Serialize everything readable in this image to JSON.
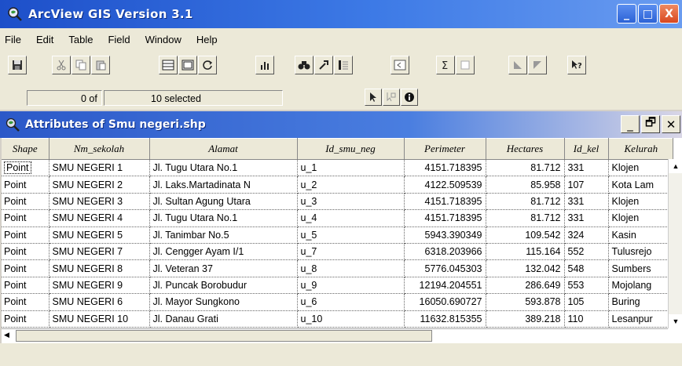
{
  "app": {
    "title": "ArcView GIS Version 3.1",
    "window_buttons": {
      "minimize": "_",
      "maximize": "□",
      "close": "X"
    }
  },
  "menu": [
    "File",
    "Edit",
    "Table",
    "Field",
    "Window",
    "Help"
  ],
  "status": {
    "count_value": "0 of",
    "selected_value": "10 selected"
  },
  "attributes_window": {
    "title": "Attributes of Smu negeri.shp",
    "buttons": {
      "minimize": "_",
      "restore": "🗗",
      "close": "✕"
    }
  },
  "table": {
    "columns": [
      "Shape",
      "Nm_sekolah",
      "Alamat",
      "Id_smu_neg",
      "Perimeter",
      "Hectares",
      "Id_kel",
      "Kelurah"
    ],
    "rows": [
      [
        "Point",
        "SMU NEGERI 1",
        "Jl. Tugu Utara No.1",
        "u_1",
        "4151.718395",
        "81.712",
        "331",
        "Klojen"
      ],
      [
        "Point",
        "SMU NEGERI 2",
        "Jl. Laks.Martadinata N",
        "u_2",
        "4122.509539",
        "85.958",
        "107",
        "Kota Lam"
      ],
      [
        "Point",
        "SMU NEGERI 3",
        "Jl. Sultan Agung Utara",
        "u_3",
        "4151.718395",
        "81.712",
        "331",
        "Klojen"
      ],
      [
        "Point",
        "SMU NEGERI 4",
        "Jl. Tugu Utara No.1",
        "u_4",
        "4151.718395",
        "81.712",
        "331",
        "Klojen"
      ],
      [
        "Point",
        "SMU NEGERI 5",
        "Jl. Tanimbar No.5",
        "u_5",
        "5943.390349",
        "109.542",
        "324",
        "Kasin"
      ],
      [
        "Point",
        "SMU NEGERI 7",
        "Jl. Cengger Ayam I/1",
        "u_7",
        "6318.203966",
        "115.164",
        "552",
        "Tulusrejo"
      ],
      [
        "Point",
        "SMU NEGERI 8",
        "Jl. Veteran 37",
        "u_8",
        "5776.045303",
        "132.042",
        "548",
        "Sumbers"
      ],
      [
        "Point",
        "SMU NEGERI 9",
        "Jl. Puncak Borobudur",
        "u_9",
        "12194.204551",
        "286.649",
        "553",
        "Mojolang"
      ],
      [
        "Point",
        "SMU NEGERI 6",
        "Jl. Mayor Sungkono",
        "u_6",
        "16050.690727",
        "593.878",
        "105",
        "Buring"
      ],
      [
        "Point",
        "SMU NEGERI 10",
        "Jl. Danau Grati",
        "u_10",
        "11632.815355",
        "389.218",
        "110",
        "Lesanpur"
      ]
    ]
  },
  "icons": [
    "save-icon",
    "cut-icon",
    "copy-icon",
    "paste-icon",
    "select-all-icon",
    "select-none-icon",
    "refresh-icon",
    "chart-icon",
    "find-icon",
    "query-icon",
    "sort-icon",
    "promote-icon",
    "summarize-icon",
    "calculate-icon",
    "sort-ascending-icon",
    "sort-descending-icon",
    "help-icon",
    "pointer-icon",
    "edit-cursor-icon",
    "info-icon"
  ],
  "colors": {
    "title_bar": "#2b58c8",
    "close_button": "#d9471f",
    "chrome": "#ece9d8"
  }
}
